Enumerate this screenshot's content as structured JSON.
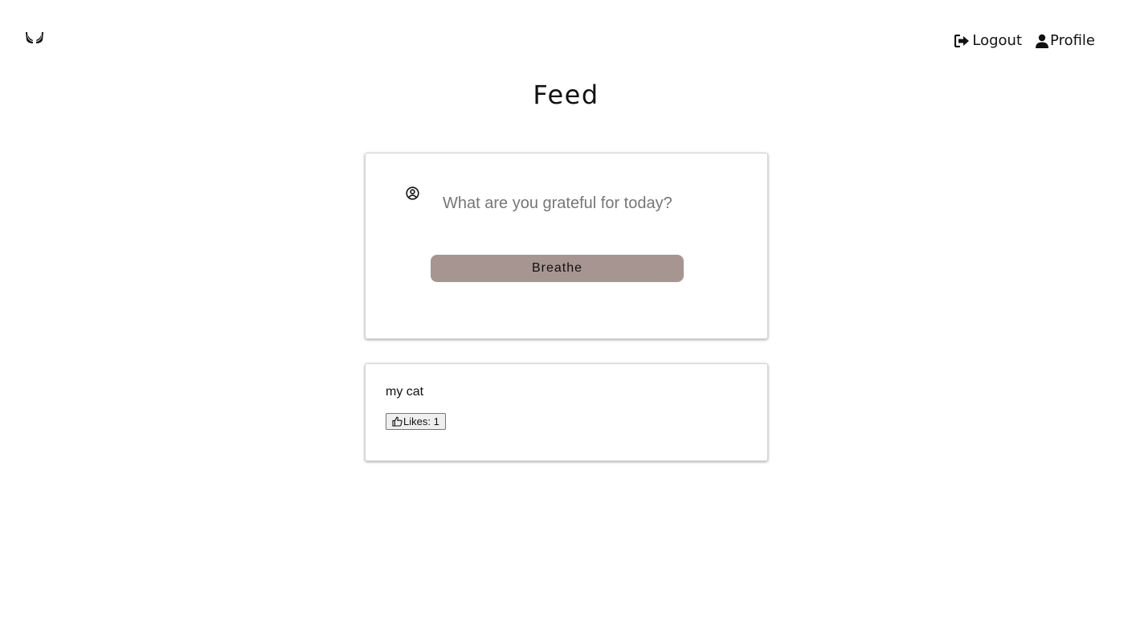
{
  "brand": {
    "logo_icon": "praying-hands-icon"
  },
  "nav": {
    "logout_label": "Logout",
    "logout_icon": "logout-icon",
    "profile_label": "Profile",
    "profile_icon": "user-icon"
  },
  "page": {
    "title": "Feed"
  },
  "composer": {
    "avatar_icon": "user-circle-icon",
    "placeholder": "What are you grateful for today?",
    "value": "",
    "submit_label": "Breathe",
    "submit_color": "#a69590"
  },
  "posts": [
    {
      "text": "my cat",
      "like_icon": "thumbs-up-icon",
      "likes_label": "Likes: 1"
    }
  ]
}
